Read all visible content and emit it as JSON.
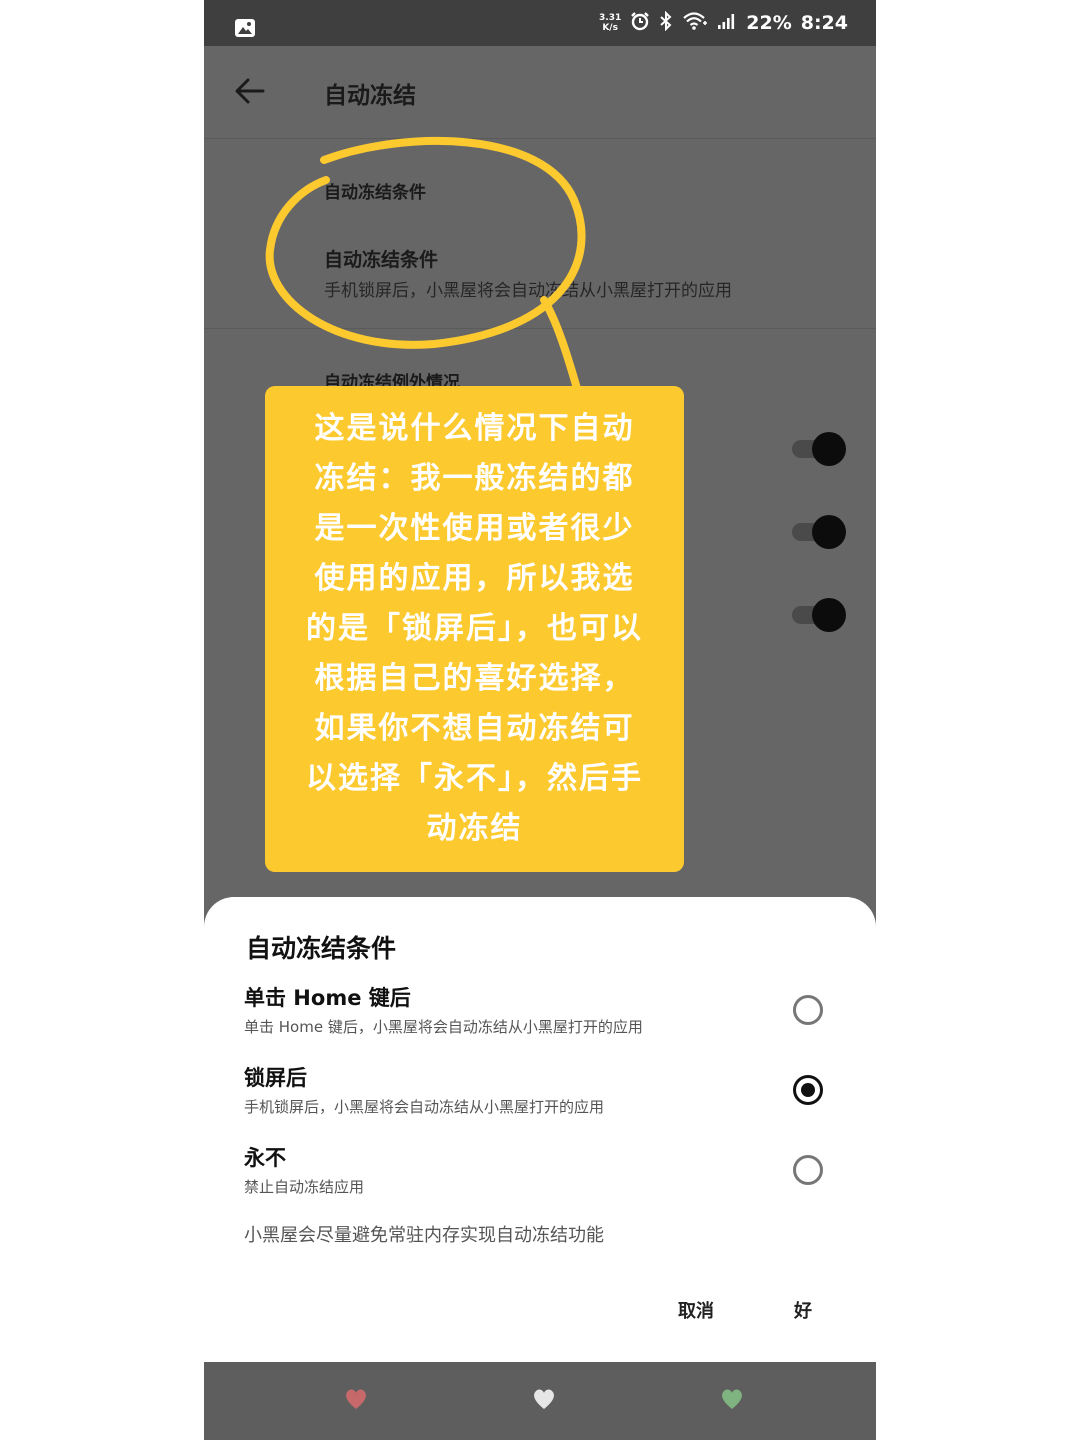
{
  "status_bar": {
    "net_speed_value": "3.31",
    "net_speed_unit": "K/s",
    "battery": "22%",
    "time": "8:24",
    "icons": [
      "gallery-icon",
      "alarm-icon",
      "bluetooth-icon",
      "wifi-icon",
      "signal-icon"
    ]
  },
  "app_bar": {
    "title": "自动冻结"
  },
  "settings": {
    "section1_header": "自动冻结条件",
    "condition_title": "自动冻结条件",
    "condition_summary": "手机锁屏后，小黑屋将会自动冻结从小黑屋打开的应用",
    "section2_header": "自动冻结例外情况",
    "toggles": [
      true,
      true,
      true
    ]
  },
  "annotation": {
    "note_lines": [
      "这是说什么情况下自动",
      "冻结：我一般冻结的都",
      "是一次性使用或者很少",
      "使用的应用，所以我选",
      "的是「锁屏后」，也可以",
      "根据自己的喜好选择，",
      "如果你不想自动冻结可",
      "以选择「永不」，然后手",
      "动冻结"
    ],
    "box_color": "#fcc92f",
    "circle_color": "#fcc92f"
  },
  "dialog": {
    "title": "自动冻结条件",
    "options": [
      {
        "title": "单击 Home 键后",
        "summary": "单击 Home 键后，小黑屋将会自动冻结从小黑屋打开的应用",
        "checked": false
      },
      {
        "title": "锁屏后",
        "summary": "手机锁屏后，小黑屋将会自动冻结从小黑屋打开的应用",
        "checked": true
      },
      {
        "title": "永不",
        "summary": "禁止自动冻结应用",
        "checked": false
      }
    ],
    "footer_note": "小黑屋会尽量避免常驻内存实现自动冻结功能",
    "cancel_label": "取消",
    "ok_label": "好"
  },
  "nav_bar": {
    "icons": [
      "heart-icon-red",
      "heart-icon-white",
      "heart-icon-green"
    ],
    "colors": [
      "#c7696b",
      "#e6e6e6",
      "#7fb37f"
    ]
  }
}
